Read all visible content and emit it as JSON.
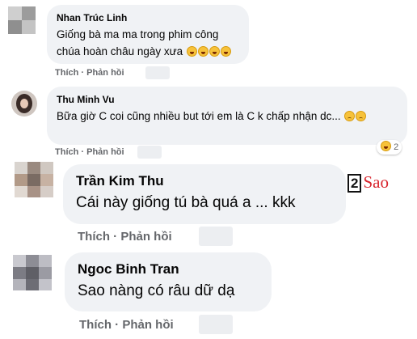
{
  "comments": [
    {
      "author": "Nhan Trúc Linh",
      "text": "Giống bà ma ma trong phim công chúa hoàn châu ngày xưa",
      "emojis": [
        "laugh",
        "laugh",
        "laugh",
        "laugh"
      ],
      "actions": {
        "like": "Thích",
        "reply": "Phản hồi"
      }
    },
    {
      "author": "Thu Minh Vu",
      "text": "Bữa giờ C coi cũng nhiều but tới em là C k chấp nhận dc...",
      "emojis": [
        "sad",
        "sad"
      ],
      "reaction_count": "2",
      "actions": {
        "like": "Thích",
        "reply": "Phản hồi"
      }
    },
    {
      "author": "Trần Kim Thu",
      "text": "Cái này giống tú bà quá a ... kkk",
      "actions": {
        "like": "Thích",
        "reply": "Phản hồi"
      }
    },
    {
      "author": "Ngoc Binh Tran",
      "text": "Sao nàng có râu dữ dạ",
      "actions": {
        "like": "Thích",
        "reply": "Phản hồi"
      }
    }
  ],
  "watermark": {
    "number": "2",
    "text": "Sao"
  },
  "colors": {
    "bubble": "#f0f2f5",
    "meta": "#65676b",
    "text": "#050505",
    "watermark": "#d8262e"
  }
}
